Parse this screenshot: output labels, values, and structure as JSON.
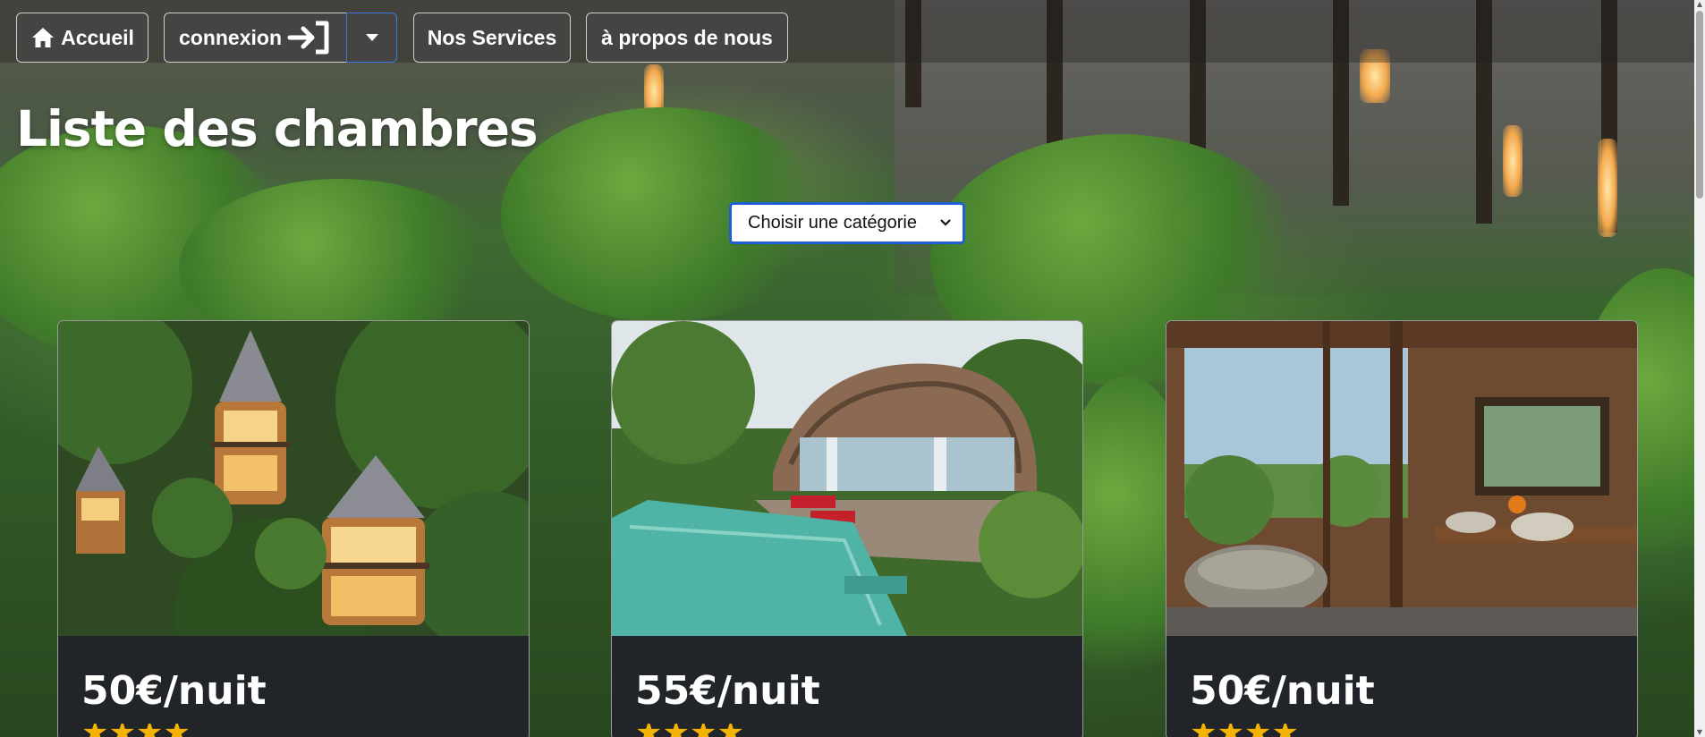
{
  "nav": {
    "home_label": "Accueil",
    "login_label": "connexion",
    "services_label": "Nos Services",
    "about_label": "à propos de nous"
  },
  "page": {
    "title": "Liste des chambres"
  },
  "filter": {
    "selected": "Choisir une catégorie"
  },
  "cards": [
    {
      "price": "50€/nuit",
      "stars": "★★★★",
      "photo": "treehouse-villas"
    },
    {
      "price": "55€/nuit",
      "stars": "★★★★",
      "photo": "pool-villa"
    },
    {
      "price": "50€/nuit",
      "stars": "★★★★",
      "photo": "jungle-bathroom"
    }
  ],
  "colors": {
    "card_body": "#212529",
    "star": "#f5b301",
    "select_border": "#1f5fd6"
  }
}
